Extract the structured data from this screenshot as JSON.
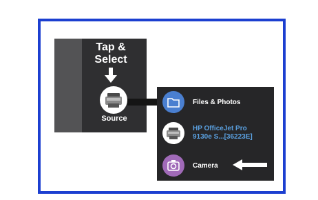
{
  "source_panel": {
    "instruction": "Tap &\nSelect",
    "source_label": "Source",
    "source_icon": "printer-icon"
  },
  "menu": {
    "items": [
      {
        "label": "Files & Photos",
        "icon": "folder-icon",
        "color": "#4a7fd0"
      },
      {
        "label": "HP OfficeJet Pro\n9130e S...[36223E]",
        "icon": "printer-icon",
        "color": "#5aa0e0"
      },
      {
        "label": "Camera",
        "icon": "camera-icon",
        "color": "#a06ab8"
      }
    ]
  },
  "colors": {
    "frame_border": "#1c3fd0",
    "panel_bg": "#2f2f31",
    "menu_bg": "#262628"
  }
}
